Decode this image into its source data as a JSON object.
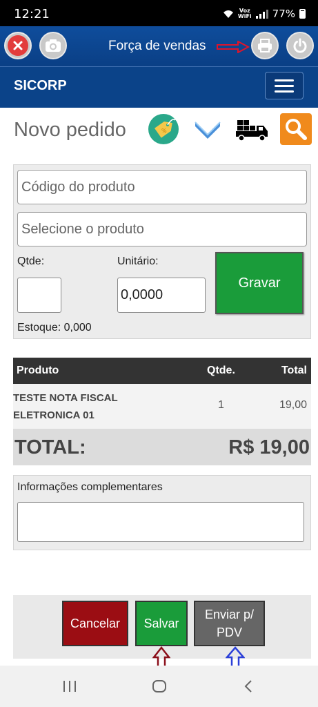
{
  "status_bar": {
    "time": "12:21",
    "carrier_line1": "Voz",
    "carrier_line2": "WiFi",
    "battery": "77%"
  },
  "header": {
    "title": "Força de vendas"
  },
  "brand_bar": {
    "brand": "SICORP"
  },
  "page": {
    "title": "Novo pedido"
  },
  "form": {
    "product_code_placeholder": "Código do produto",
    "product_select_placeholder": "Selecione o produto",
    "qty_label": "Qtde:",
    "qty_value": "",
    "unit_label": "Unitário:",
    "unit_value": "0,0000",
    "save_item_label": "Gravar",
    "stock_text": "Estoque: 0,000"
  },
  "table": {
    "columns": [
      "Produto",
      "Qtde.",
      "Total"
    ],
    "rows": [
      {
        "product": "TESTE NOTA FISCAL ELETRONICA 01",
        "qty": "1",
        "total": "19,00"
      }
    ],
    "total_label": "TOTAL:",
    "total_value": "R$ 19,00"
  },
  "info": {
    "label": "Informações complementares",
    "value": ""
  },
  "actions": {
    "cancel": "Cancelar",
    "save": "Salvar",
    "send": "Enviar p/ PDV"
  },
  "colors": {
    "header_blue": "#0f4d9c",
    "green": "#1a9c3a",
    "cancel_red": "#9b0d13",
    "send_gray": "#666666",
    "search_orange": "#f08a1c"
  }
}
